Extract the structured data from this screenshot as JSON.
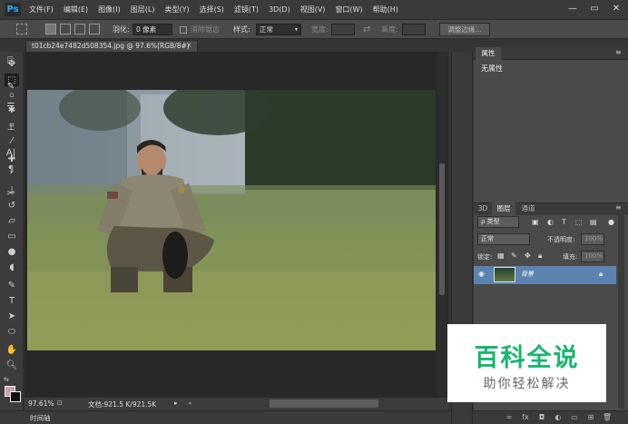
{
  "menubar": {
    "logo": "Ps",
    "items": [
      "文件(F)",
      "编辑(E)",
      "图像(I)",
      "图层(L)",
      "类型(Y)",
      "选择(S)",
      "滤镜(T)",
      "3D(D)",
      "视图(V)",
      "窗口(W)",
      "帮助(H)"
    ],
    "window_controls": [
      "—",
      "▭",
      "✕"
    ]
  },
  "options_bar": {
    "feather_label": "羽化:",
    "feather_value": "0 像素",
    "antialias_label": "消除锯齿",
    "style_label": "样式:",
    "style_value": "正常",
    "width_label": "宽度:",
    "height_label": "高度:",
    "refine_edge_button": "调整边缘..."
  },
  "document": {
    "tab_title": "t01cb24e7482d508354.jpg @ 97.6%(RGB/8#)",
    "zoom": "97.61%",
    "doc_info": "文档:921.5 K/921.5K"
  },
  "timeline": {
    "label": "时间轴"
  },
  "properties": {
    "tab": "属性",
    "content": "无属性"
  },
  "layers": {
    "tabs": [
      "3D",
      "图层",
      "通道"
    ],
    "active_tab": "图层",
    "filter_kind": "ρ 类型",
    "blend_mode": "正常",
    "opacity_label": "不透明度:",
    "opacity_value": "100%",
    "lock_label": "锁定:",
    "fill_label": "填充:",
    "fill_value": "100%",
    "layer_name": "背景"
  },
  "watermark": {
    "title": "百科全说",
    "subtitle": "助你轻松解决"
  }
}
